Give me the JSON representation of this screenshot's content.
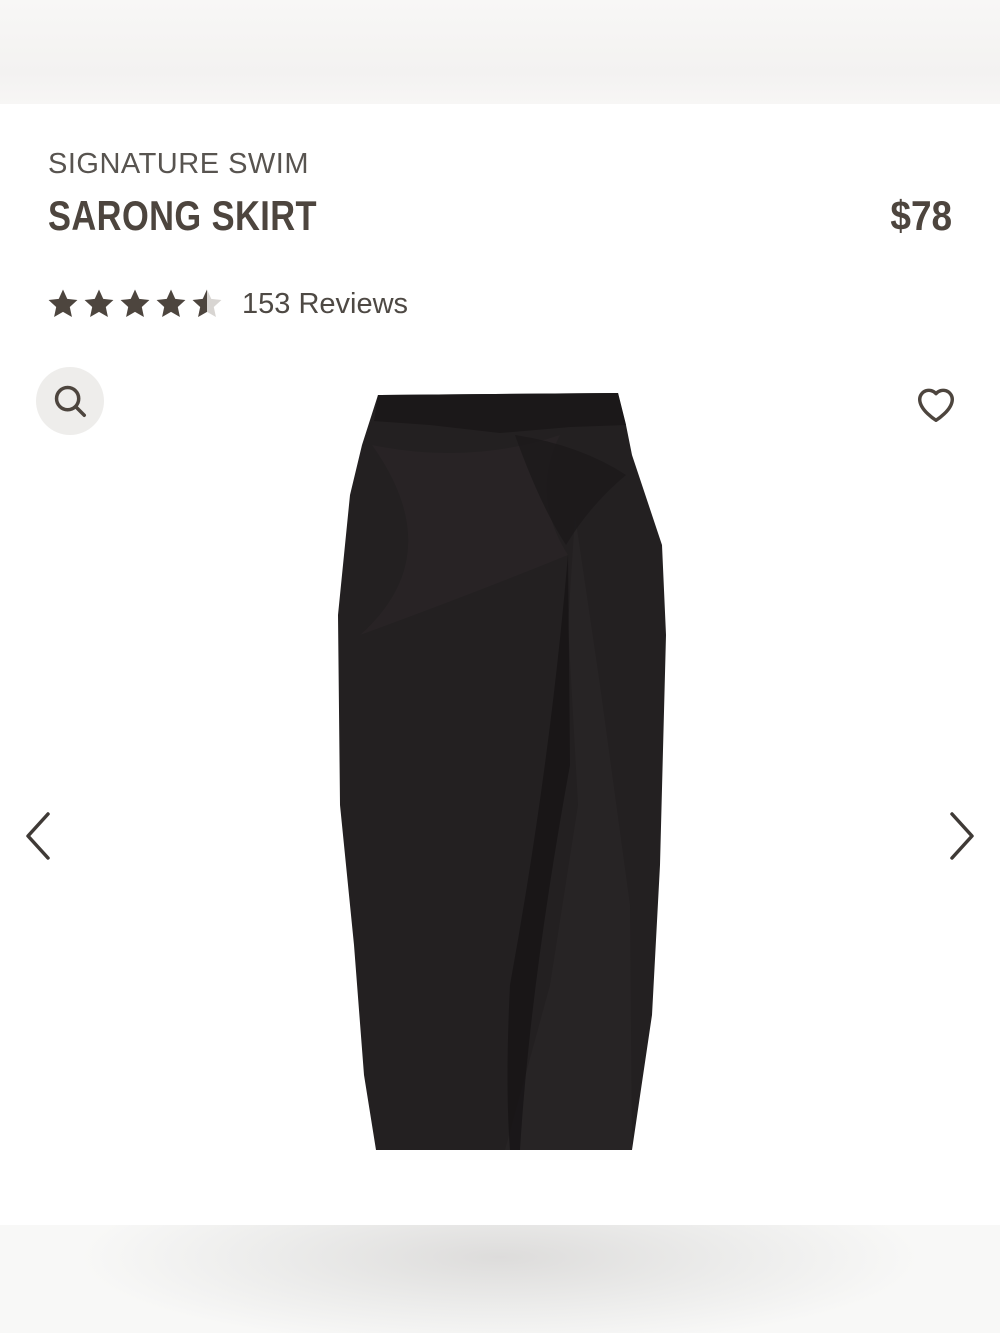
{
  "product": {
    "collection": "SIGNATURE SWIM",
    "name": "SARONG SKIRT",
    "price": "$78"
  },
  "rating": {
    "value": 4.5,
    "max": 5,
    "reviews_label": "153 Reviews"
  },
  "icons": {
    "zoom": "search-icon",
    "wishlist": "heart-icon",
    "prev": "chevron-left-icon",
    "next": "chevron-right-icon"
  },
  "gallery": {
    "image_subject": "black sarong skirt with twisted front knot"
  },
  "colors": {
    "text_primary": "#4d453e",
    "star": "#4d453e",
    "zoom_bg": "#eeedeb",
    "skirt": "#232021"
  }
}
